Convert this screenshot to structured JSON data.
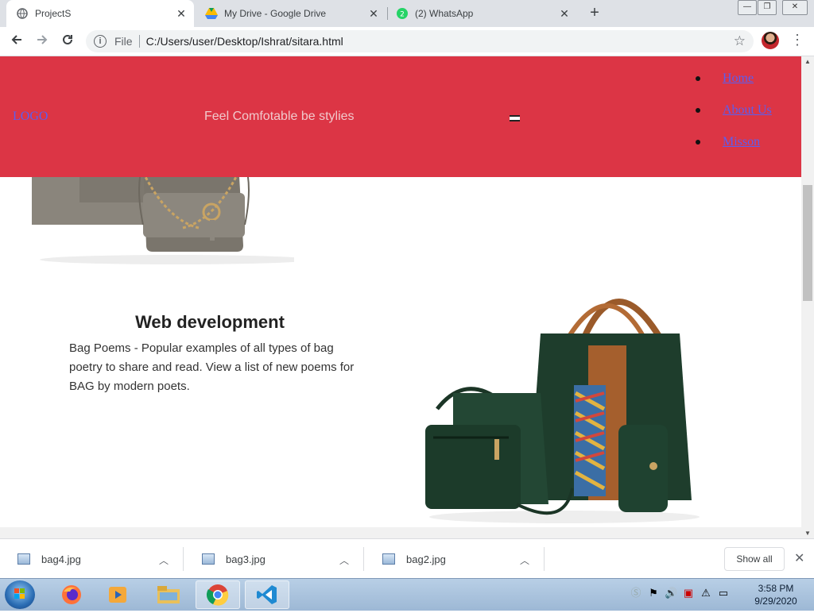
{
  "browser": {
    "tabs": [
      {
        "title": "ProjectS",
        "active": true,
        "icon": "globe-icon"
      },
      {
        "title": "My Drive - Google Drive",
        "active": false,
        "icon": "google-drive-icon"
      },
      {
        "title": "(2) WhatsApp",
        "active": false,
        "icon": "whatsapp-icon"
      }
    ],
    "omnibox": {
      "scheme_label": "File",
      "url": "C:/Users/user/Desktop/Ishrat/sitara.html"
    }
  },
  "page": {
    "navbar": {
      "logo": "LOGO",
      "tagline": "Feel Comfotable be stylies",
      "menu": [
        "Home",
        "About Us",
        "Misson"
      ],
      "bg_color": "#dc3545",
      "link_color": "#5a5ef0"
    },
    "section": {
      "heading": "Web development",
      "body": "Bag Poems - Popular examples of all types of bag poetry to share and read. View a list of new poems for BAG by modern poets."
    }
  },
  "downloads": {
    "items": [
      "bag4.jpg",
      "bag3.jpg",
      "bag2.jpg"
    ],
    "show_all": "Show all"
  },
  "taskbar": {
    "apps": [
      "firefox-icon",
      "media-player-icon",
      "file-explorer-icon",
      "chrome-icon",
      "vscode-icon"
    ],
    "time": "3:58 PM",
    "date": "9/29/2020"
  }
}
